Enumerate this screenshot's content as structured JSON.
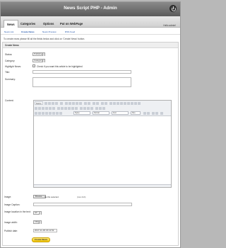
{
  "header": {
    "title": "News Script PHP - Admin",
    "power_icon": "power-icon"
  },
  "tabs": [
    {
      "label": "News",
      "active": true
    },
    {
      "label": "Categories",
      "active": false
    },
    {
      "label": "Options",
      "active": false
    },
    {
      "label": "Put on WebPage",
      "active": false
    }
  ],
  "user": {
    "label": "Hello admin!"
  },
  "subnav": [
    {
      "label": "News List"
    },
    {
      "label": "Create News"
    },
    {
      "label": "News Preview"
    },
    {
      "label": "RSS Feed"
    }
  ],
  "instructions": "To create news please fill all the fields below and click on 'Create News' button.",
  "form": {
    "title": "Create News",
    "status": {
      "label": "Status:",
      "value": "Published"
    },
    "category": {
      "label": "Category:",
      "value": "Category1"
    },
    "highlight": {
      "label": "Highlight News:",
      "checkbox_label": "Check if you want this article to be highlighted"
    },
    "title_field": {
      "label": "Title:",
      "value": ""
    },
    "summary": {
      "label": "Summary:",
      "value": ""
    },
    "content": {
      "label": "Content:",
      "toolbar": {
        "source_label": "Source",
        "style_label": "Styles",
        "format_label": "Normal",
        "font_label": "Font",
        "size_label": "Size"
      }
    },
    "image": {
      "label": "Image:",
      "browse_label": "Browse...",
      "file_status": "No file selected.",
      "max_note": "(max 2mb)"
    },
    "image_caption": {
      "label": "Image Caption:",
      "value": ""
    },
    "image_location": {
      "label": "Image location in the text:",
      "value": "left"
    },
    "image_width": {
      "label": "Image width:",
      "value": "150px"
    },
    "publish_date": {
      "label": "Publish date:",
      "value": "2017-11-30 16:11:52"
    },
    "submit_label": "Create News"
  },
  "colors": {
    "header_bg": "#6e6e6e",
    "link": "#2255aa",
    "submit_bg": "#f5d227"
  }
}
